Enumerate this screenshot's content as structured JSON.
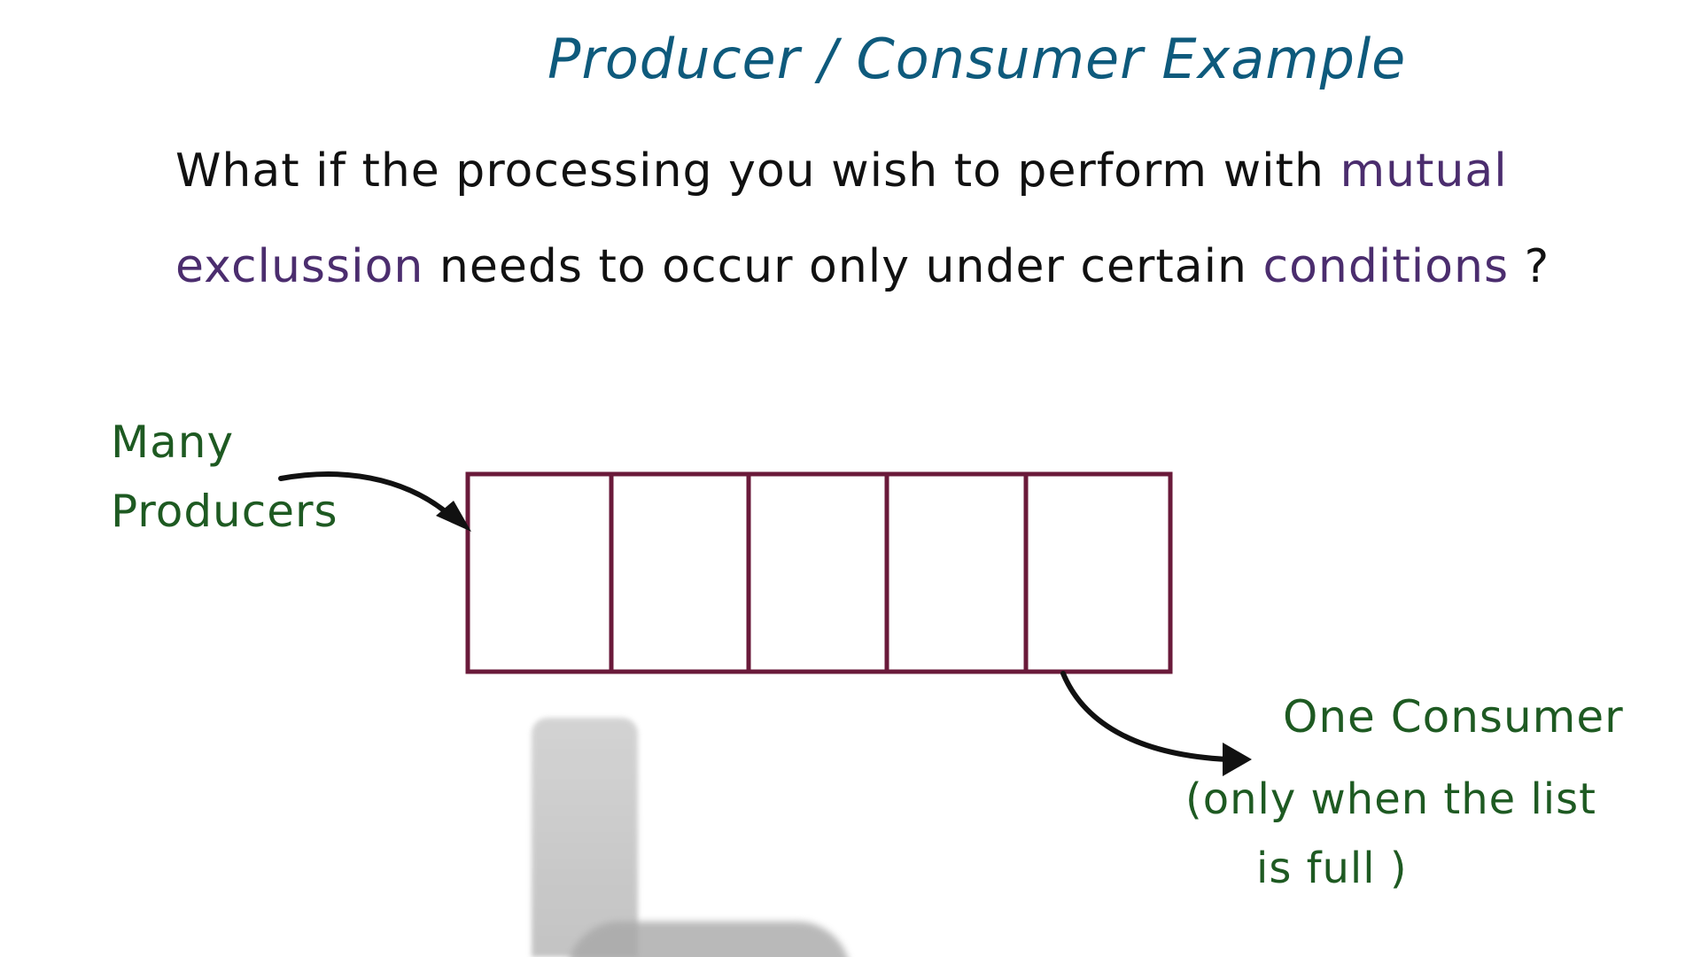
{
  "title": "Producer / Consumer Example",
  "question": {
    "line1_a": "What if the processing you wish to perform with ",
    "line1_accent": "mutual",
    "line2_accent1": "exclussion",
    "line2_b": " needs to occur only under certain ",
    "line2_accent2": "conditions",
    "line2_end": " ?"
  },
  "labels": {
    "producers_line1": "Many",
    "producers_line2": "Producers",
    "consumer": "One Consumer",
    "consumer_note_line1": "(only when the list",
    "consumer_note_line2": "is full )"
  },
  "buffer": {
    "slot_count": 5
  },
  "colors": {
    "title": "#0e5a7c",
    "question_text": "#111111",
    "accent_purple": "#4b2d6e",
    "labels_green": "#1e5a22",
    "buffer_outline": "#6a1a3a",
    "arrows": "#111111"
  }
}
